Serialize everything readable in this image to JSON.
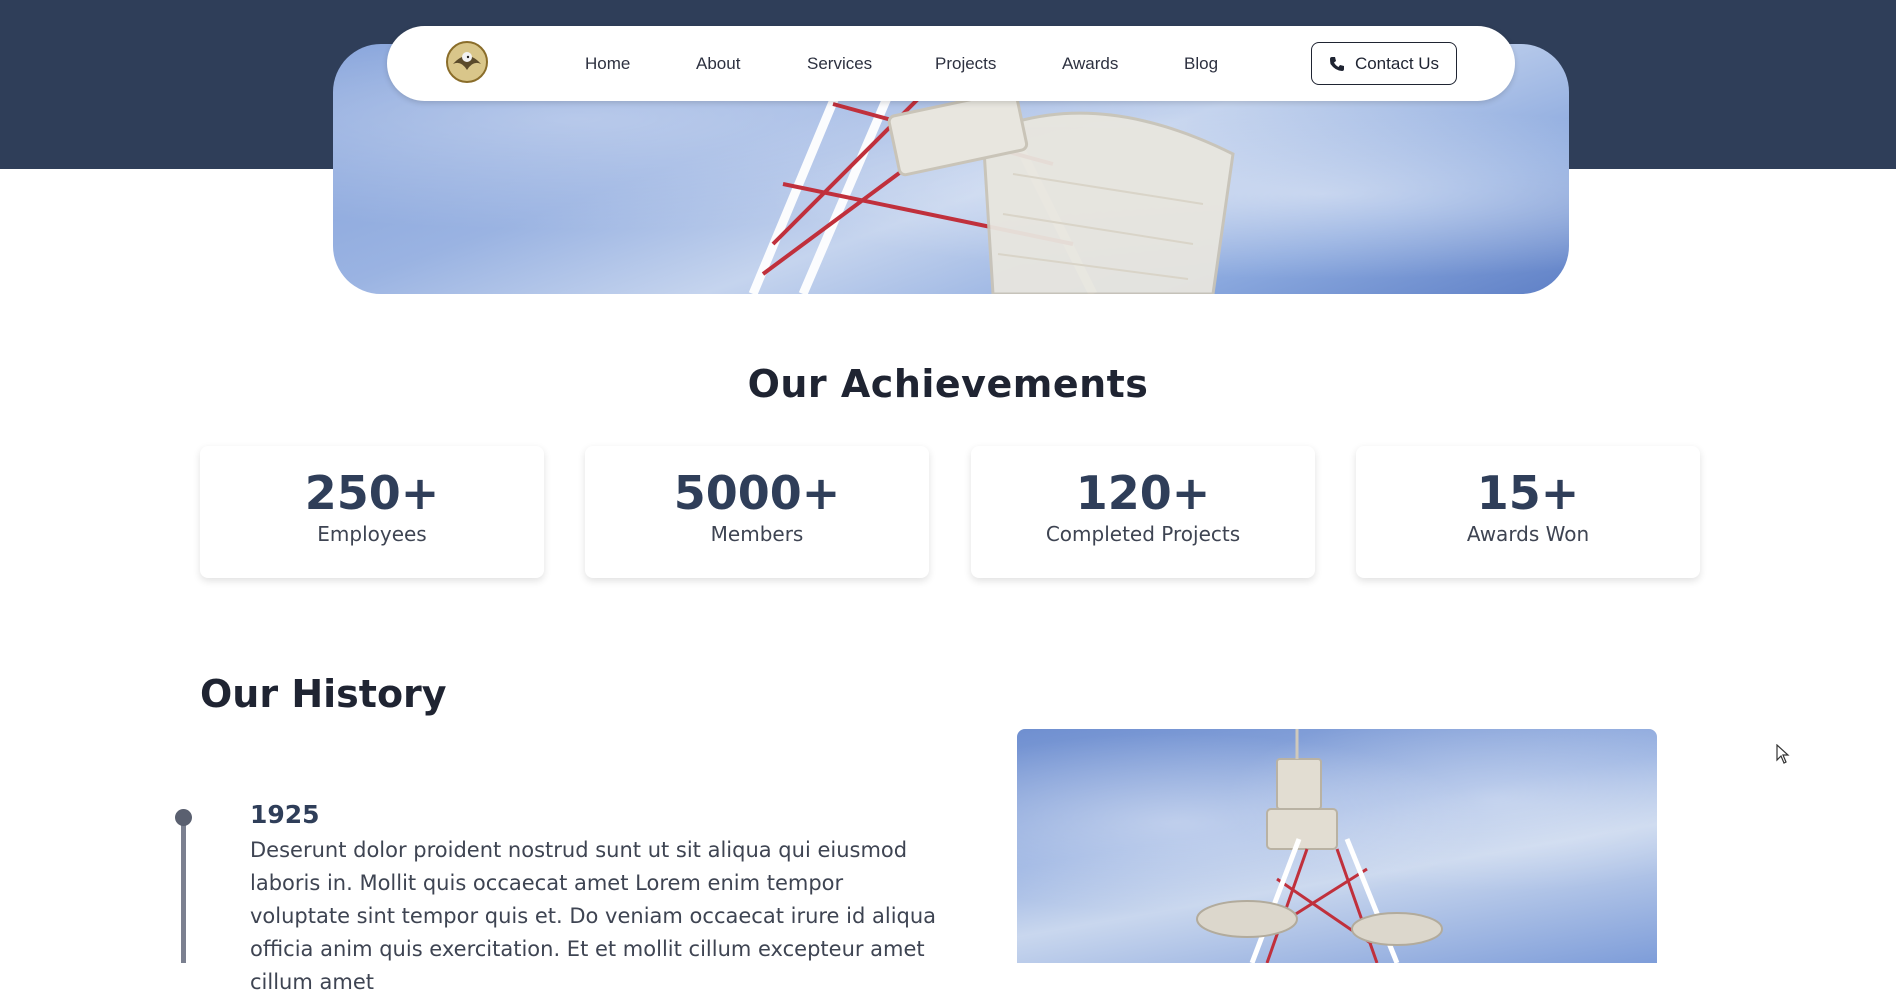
{
  "nav": {
    "logo_icon": "eagle-emblem-logo",
    "items": [
      "Home",
      "About",
      "Services",
      "Projects",
      "Awards",
      "Blog"
    ],
    "contact": {
      "label": "Contact Us",
      "icon": "phone-icon"
    }
  },
  "hero": {
    "image": "telecom-tower-sky"
  },
  "achievements": {
    "title": "Our Achievements",
    "cards": [
      {
        "value": "250+",
        "label": "Employees"
      },
      {
        "value": "5000+",
        "label": "Members"
      },
      {
        "value": "120+",
        "label": "Completed Projects"
      },
      {
        "value": "15+",
        "label": "Awards Won"
      }
    ]
  },
  "history": {
    "title": "Our History",
    "entries": [
      {
        "year": "1925",
        "text": "Deserunt dolor proident nostrud sunt ut sit aliqua qui eiusmod laboris in. Mollit quis occaecat amet Lorem enim tempor voluptate sint tempor quis et. Do veniam occaecat irure id aliqua officia anim quis exercitation. Et et mollit cillum excepteur amet cillum amet"
      }
    ],
    "image": "telecom-tower-sky"
  },
  "colors": {
    "header_band": "#2f3e59",
    "accent_navy": "#2f3e59",
    "text_dark": "#1f2432"
  }
}
